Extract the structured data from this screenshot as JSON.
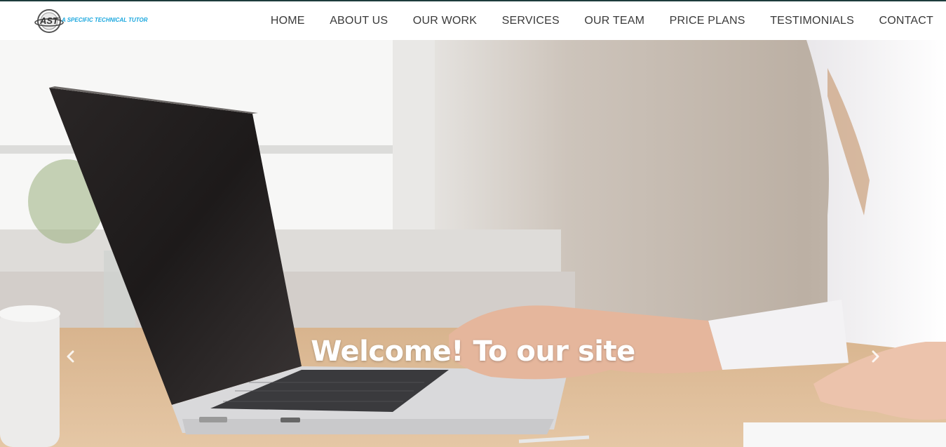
{
  "logo": {
    "mark_text": "AST",
    "tagline": "A SPECIFIC TECHNICAL TUTOR"
  },
  "nav": {
    "items": [
      {
        "label": "HOME"
      },
      {
        "label": "ABOUT US"
      },
      {
        "label": "OUR WORK"
      },
      {
        "label": "SERVICES"
      },
      {
        "label": "OUR TEAM"
      },
      {
        "label": "PRICE PLANS"
      },
      {
        "label": "TESTIMONIALS"
      },
      {
        "label": "CONTACT"
      }
    ]
  },
  "hero": {
    "caption": "Welcome! To our site",
    "prev_icon": "chevron-left-icon",
    "next_icon": "chevron-right-icon"
  },
  "colors": {
    "brand_blue": "#1aa7de",
    "nav_text": "#3a3a3a",
    "header_bg": "#ffffff",
    "top_border": "#1d3b3b",
    "caption_text": "#ffffff"
  }
}
